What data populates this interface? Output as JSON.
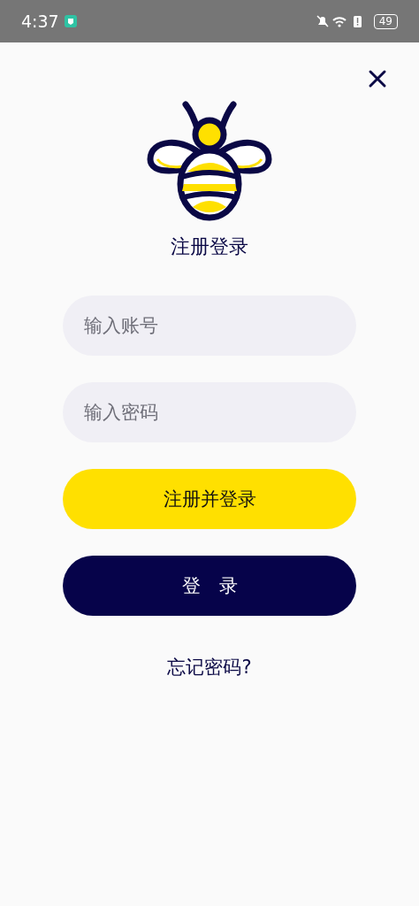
{
  "status_bar": {
    "time": "4:37",
    "battery": "49"
  },
  "title": "注册登录",
  "fields": [
    {
      "placeholder": "输入账号"
    },
    {
      "placeholder": "输入密码"
    }
  ],
  "buttons": [
    {
      "label": "注册并登录",
      "kind": "primary"
    },
    {
      "label": "登　录",
      "kind": "dark"
    }
  ],
  "forgot_link": "忘记密码?"
}
